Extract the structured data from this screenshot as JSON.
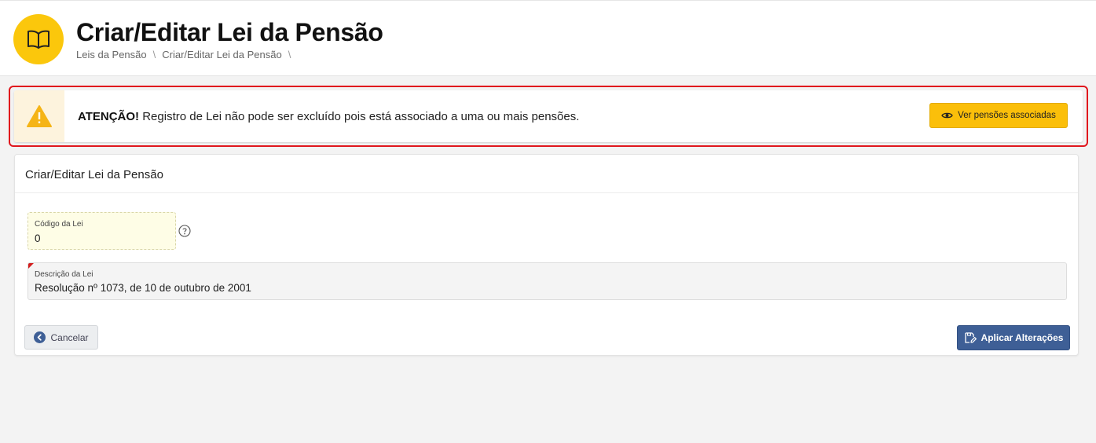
{
  "header": {
    "title": "Criar/Editar Lei da Pensão",
    "breadcrumb": [
      "Leis da Pensão",
      "Criar/Editar Lei da Pensão"
    ],
    "separator": "\\",
    "logo_icon": "open-book-icon",
    "accent": "#fbc70c"
  },
  "alert": {
    "strong": "ATENÇÃO!",
    "message": " Registro de Lei não pode ser excluído pois está associado a uma ou mais pensões.",
    "icon": "warning-triangle-icon",
    "button_label": "Ver pensões associadas",
    "button_icon": "eye-icon",
    "border_color": "#e0161d"
  },
  "form": {
    "title": "Criar/Editar Lei da Pensão",
    "codigo": {
      "label": "Código da Lei",
      "value": "0"
    },
    "descricao": {
      "label": "Descrição da Lei",
      "value": "Resolução nº 1073, de 10 de outubro de 2001"
    },
    "cancel_label": "Cancelar",
    "apply_label": "Aplicar Alterações",
    "primary_color": "#3e5f96"
  }
}
